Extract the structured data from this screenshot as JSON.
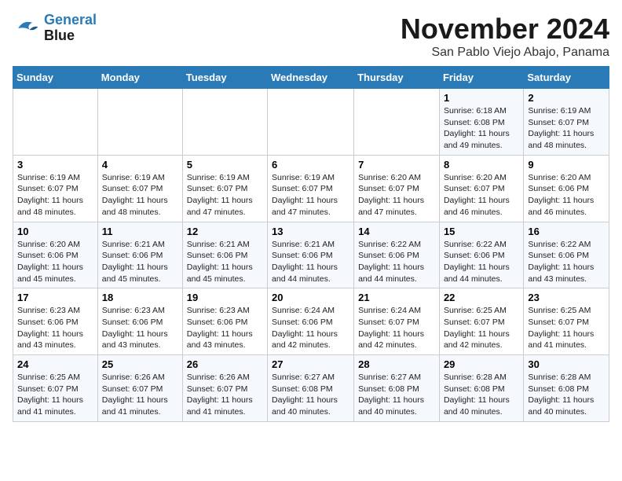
{
  "logo": {
    "line1": "General",
    "line2": "Blue"
  },
  "title": "November 2024",
  "subtitle": "San Pablo Viejo Abajo, Panama",
  "days_of_week": [
    "Sunday",
    "Monday",
    "Tuesday",
    "Wednesday",
    "Thursday",
    "Friday",
    "Saturday"
  ],
  "weeks": [
    [
      {
        "day": "",
        "info": ""
      },
      {
        "day": "",
        "info": ""
      },
      {
        "day": "",
        "info": ""
      },
      {
        "day": "",
        "info": ""
      },
      {
        "day": "",
        "info": ""
      },
      {
        "day": "1",
        "info": "Sunrise: 6:18 AM\nSunset: 6:08 PM\nDaylight: 11 hours\nand 49 minutes."
      },
      {
        "day": "2",
        "info": "Sunrise: 6:19 AM\nSunset: 6:07 PM\nDaylight: 11 hours\nand 48 minutes."
      }
    ],
    [
      {
        "day": "3",
        "info": "Sunrise: 6:19 AM\nSunset: 6:07 PM\nDaylight: 11 hours\nand 48 minutes."
      },
      {
        "day": "4",
        "info": "Sunrise: 6:19 AM\nSunset: 6:07 PM\nDaylight: 11 hours\nand 48 minutes."
      },
      {
        "day": "5",
        "info": "Sunrise: 6:19 AM\nSunset: 6:07 PM\nDaylight: 11 hours\nand 47 minutes."
      },
      {
        "day": "6",
        "info": "Sunrise: 6:19 AM\nSunset: 6:07 PM\nDaylight: 11 hours\nand 47 minutes."
      },
      {
        "day": "7",
        "info": "Sunrise: 6:20 AM\nSunset: 6:07 PM\nDaylight: 11 hours\nand 47 minutes."
      },
      {
        "day": "8",
        "info": "Sunrise: 6:20 AM\nSunset: 6:07 PM\nDaylight: 11 hours\nand 46 minutes."
      },
      {
        "day": "9",
        "info": "Sunrise: 6:20 AM\nSunset: 6:06 PM\nDaylight: 11 hours\nand 46 minutes."
      }
    ],
    [
      {
        "day": "10",
        "info": "Sunrise: 6:20 AM\nSunset: 6:06 PM\nDaylight: 11 hours\nand 45 minutes."
      },
      {
        "day": "11",
        "info": "Sunrise: 6:21 AM\nSunset: 6:06 PM\nDaylight: 11 hours\nand 45 minutes."
      },
      {
        "day": "12",
        "info": "Sunrise: 6:21 AM\nSunset: 6:06 PM\nDaylight: 11 hours\nand 45 minutes."
      },
      {
        "day": "13",
        "info": "Sunrise: 6:21 AM\nSunset: 6:06 PM\nDaylight: 11 hours\nand 44 minutes."
      },
      {
        "day": "14",
        "info": "Sunrise: 6:22 AM\nSunset: 6:06 PM\nDaylight: 11 hours\nand 44 minutes."
      },
      {
        "day": "15",
        "info": "Sunrise: 6:22 AM\nSunset: 6:06 PM\nDaylight: 11 hours\nand 44 minutes."
      },
      {
        "day": "16",
        "info": "Sunrise: 6:22 AM\nSunset: 6:06 PM\nDaylight: 11 hours\nand 43 minutes."
      }
    ],
    [
      {
        "day": "17",
        "info": "Sunrise: 6:23 AM\nSunset: 6:06 PM\nDaylight: 11 hours\nand 43 minutes."
      },
      {
        "day": "18",
        "info": "Sunrise: 6:23 AM\nSunset: 6:06 PM\nDaylight: 11 hours\nand 43 minutes."
      },
      {
        "day": "19",
        "info": "Sunrise: 6:23 AM\nSunset: 6:06 PM\nDaylight: 11 hours\nand 43 minutes."
      },
      {
        "day": "20",
        "info": "Sunrise: 6:24 AM\nSunset: 6:06 PM\nDaylight: 11 hours\nand 42 minutes."
      },
      {
        "day": "21",
        "info": "Sunrise: 6:24 AM\nSunset: 6:07 PM\nDaylight: 11 hours\nand 42 minutes."
      },
      {
        "day": "22",
        "info": "Sunrise: 6:25 AM\nSunset: 6:07 PM\nDaylight: 11 hours\nand 42 minutes."
      },
      {
        "day": "23",
        "info": "Sunrise: 6:25 AM\nSunset: 6:07 PM\nDaylight: 11 hours\nand 41 minutes."
      }
    ],
    [
      {
        "day": "24",
        "info": "Sunrise: 6:25 AM\nSunset: 6:07 PM\nDaylight: 11 hours\nand 41 minutes."
      },
      {
        "day": "25",
        "info": "Sunrise: 6:26 AM\nSunset: 6:07 PM\nDaylight: 11 hours\nand 41 minutes."
      },
      {
        "day": "26",
        "info": "Sunrise: 6:26 AM\nSunset: 6:07 PM\nDaylight: 11 hours\nand 41 minutes."
      },
      {
        "day": "27",
        "info": "Sunrise: 6:27 AM\nSunset: 6:08 PM\nDaylight: 11 hours\nand 40 minutes."
      },
      {
        "day": "28",
        "info": "Sunrise: 6:27 AM\nSunset: 6:08 PM\nDaylight: 11 hours\nand 40 minutes."
      },
      {
        "day": "29",
        "info": "Sunrise: 6:28 AM\nSunset: 6:08 PM\nDaylight: 11 hours\nand 40 minutes."
      },
      {
        "day": "30",
        "info": "Sunrise: 6:28 AM\nSunset: 6:08 PM\nDaylight: 11 hours\nand 40 minutes."
      }
    ]
  ]
}
